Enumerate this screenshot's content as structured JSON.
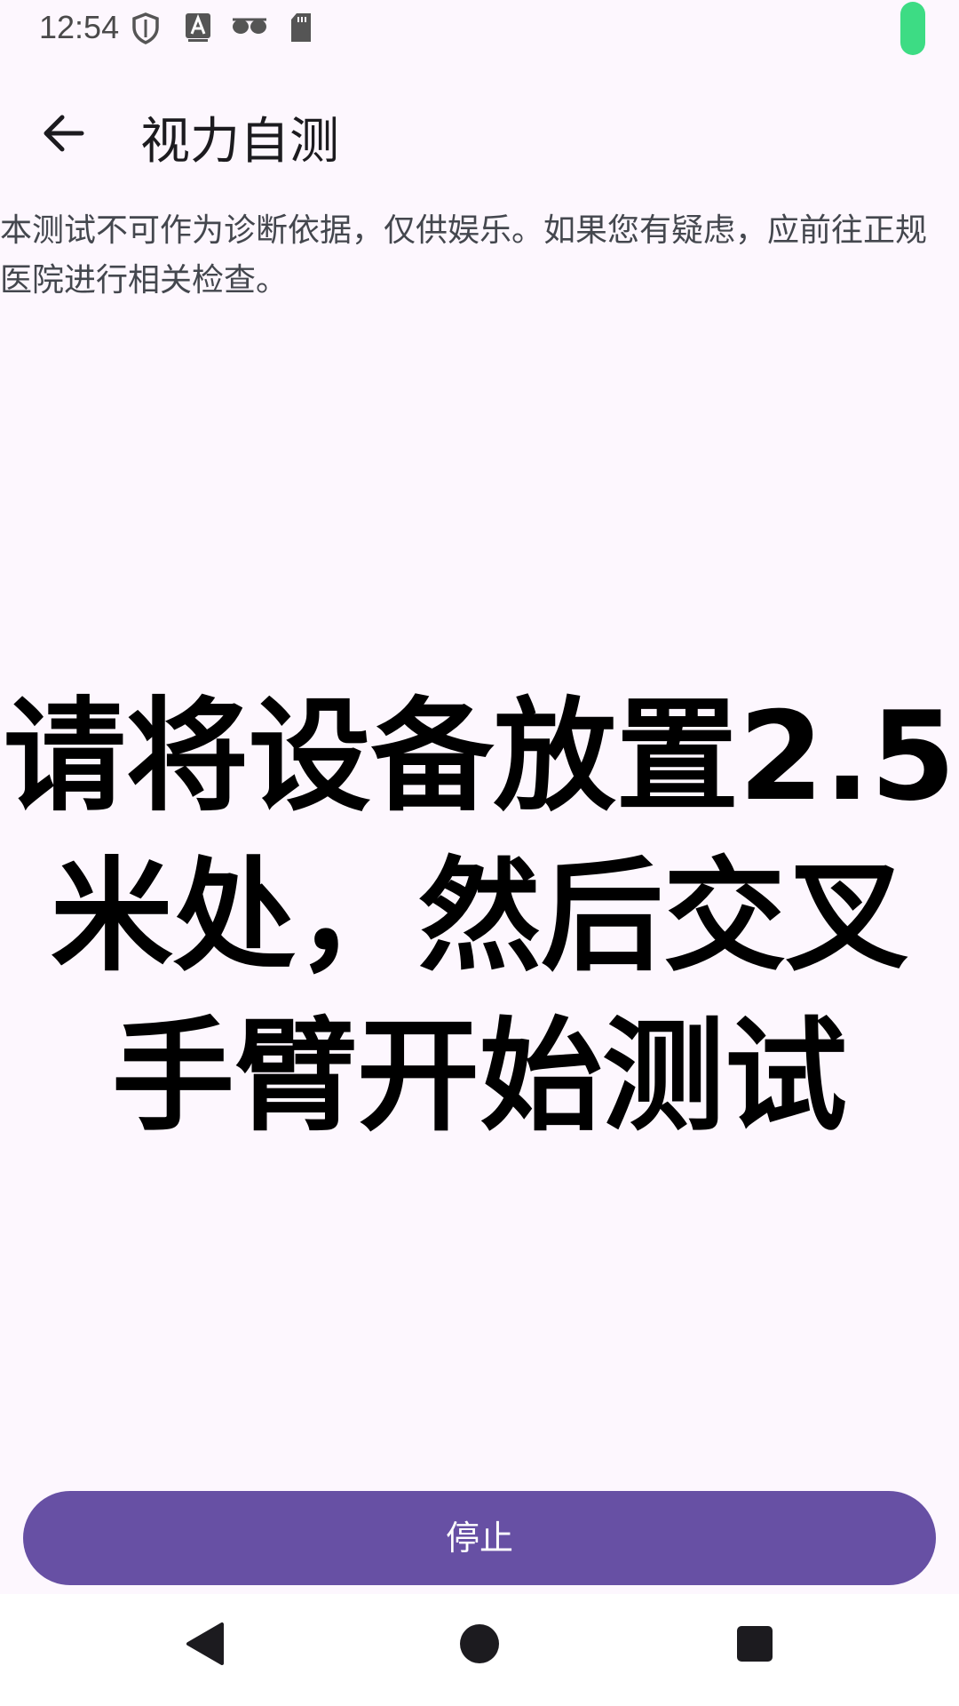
{
  "status_bar": {
    "time": "12:54",
    "icons": [
      "shield-icon",
      "font-a-icon",
      "glasses-icon",
      "sd-card-icon",
      "battery-icon"
    ],
    "battery_color": "#3ddc84"
  },
  "app_bar": {
    "back_icon": "arrow-back-icon",
    "title": "视力自测"
  },
  "disclaimer": "本测试不可作为诊断依据，仅供娱乐。如果您有疑虑，应前往正规医院进行相关检查。",
  "instruction": "请将设备放置2.5米处，然后交叉手臂开始测试",
  "stop_button": {
    "label": "停止",
    "color": "#6750a4"
  },
  "nav_bar": {
    "items": [
      "back-triangle-icon",
      "home-circle-icon",
      "recents-square-icon"
    ]
  },
  "colors": {
    "background": "#fdf7fe",
    "text_primary": "#1c1b1f",
    "accent": "#6750a4"
  }
}
